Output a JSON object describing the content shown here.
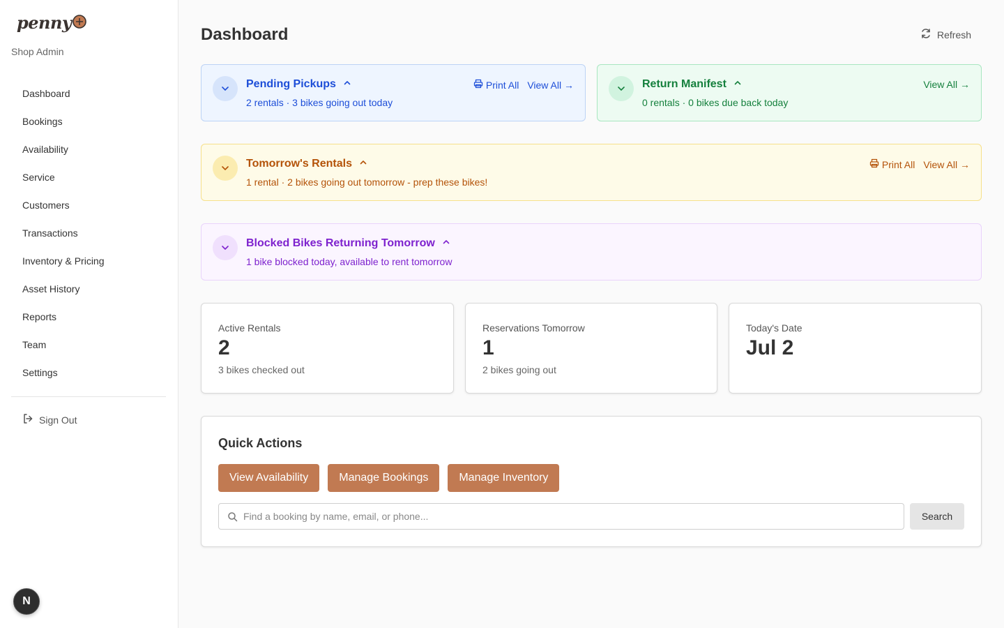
{
  "sidebar": {
    "logo_text": "penny",
    "subtitle": "Shop Admin",
    "nav": [
      {
        "label": "Dashboard"
      },
      {
        "label": "Bookings"
      },
      {
        "label": "Availability"
      },
      {
        "label": "Service"
      },
      {
        "label": "Customers"
      },
      {
        "label": "Transactions"
      },
      {
        "label": "Inventory & Pricing"
      },
      {
        "label": "Asset History"
      },
      {
        "label": "Reports"
      },
      {
        "label": "Team"
      },
      {
        "label": "Settings"
      }
    ],
    "sign_out": "Sign Out",
    "avatar_initial": "N"
  },
  "header": {
    "title": "Dashboard",
    "refresh_label": "Refresh"
  },
  "alerts": {
    "pending_pickups": {
      "title": "Pending Pickups",
      "desc": "2 rentals · 3 bikes going out today",
      "print_all": "Print All",
      "view_all": "View All →",
      "color": "#1d4ed8"
    },
    "return_manifest": {
      "title": "Return Manifest",
      "desc": "0 rentals · 0 bikes due back today",
      "view_all": "View All →",
      "color": "#15803d"
    },
    "tomorrows_rentals": {
      "title": "Tomorrow's Rentals",
      "desc": "1 rental · 2 bikes going out tomorrow - prep these bikes!",
      "print_all": "Print All",
      "view_all": "View All →",
      "color": "#b45309"
    },
    "blocked_bikes": {
      "title": "Blocked Bikes Returning Tomorrow",
      "desc": "1 bike blocked today, available to rent tomorrow",
      "color": "#7e22ce"
    }
  },
  "stats": [
    {
      "label": "Active Rentals",
      "value": "2",
      "sub": "3 bikes checked out"
    },
    {
      "label": "Reservations Tomorrow",
      "value": "1",
      "sub": "2 bikes going out"
    },
    {
      "label": "Today's Date",
      "value": "Jul 2",
      "sub": ""
    }
  ],
  "quick_actions": {
    "title": "Quick Actions",
    "buttons": [
      {
        "label": "View Availability"
      },
      {
        "label": "Manage Bookings"
      },
      {
        "label": "Manage Inventory"
      }
    ],
    "search_placeholder": "Find a booking by name, email, or phone...",
    "search_value": "",
    "search_button": "Search",
    "accent_color": "#c17a52"
  },
  "icons": [
    "penny-farthing-logo-icon",
    "sign-out-icon",
    "refresh-icon",
    "chevron-down-icon",
    "chevron-up-icon",
    "printer-icon",
    "search-icon"
  ]
}
